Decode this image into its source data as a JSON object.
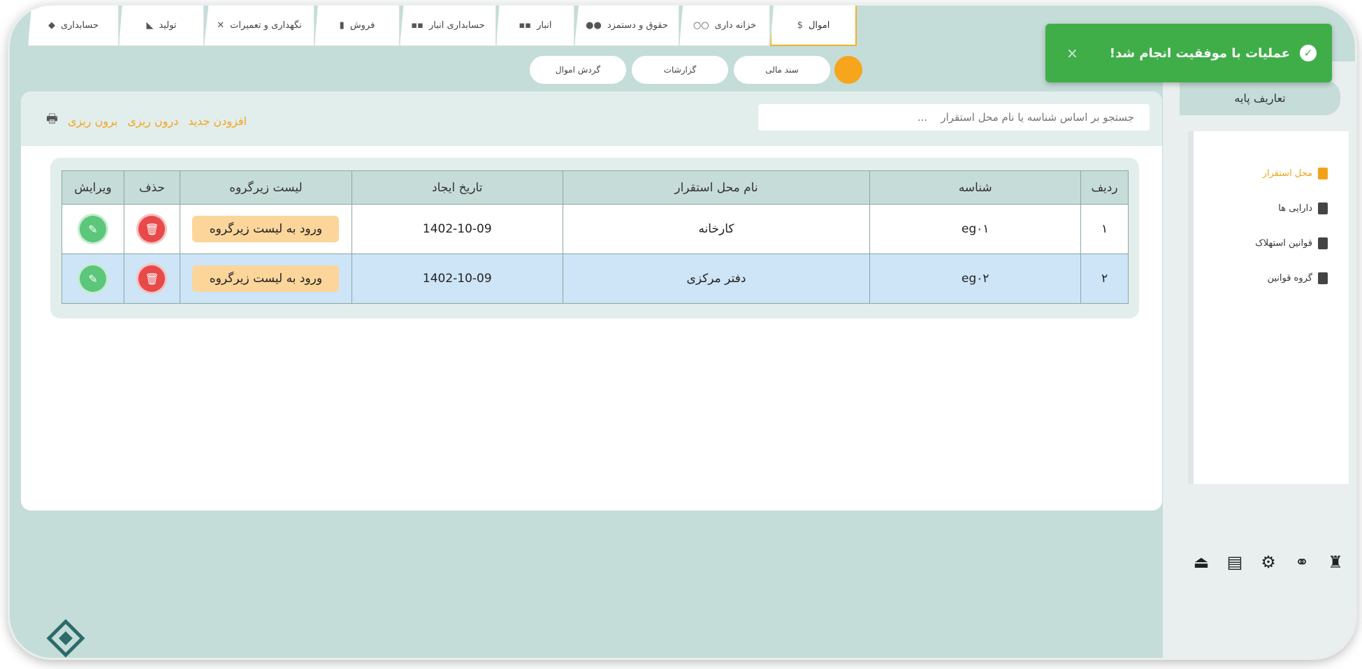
{
  "tabs": [
    {
      "label": "اموال",
      "icon": "money-doc-icon",
      "active": true
    },
    {
      "label": "خزانه داری",
      "icon": "coins-icon"
    },
    {
      "label": "حقوق و دستمزد",
      "icon": "users-icon"
    },
    {
      "label": "انبار",
      "icon": "boxes-icon"
    },
    {
      "label": "حسابداری انبار",
      "icon": "boxes-icon"
    },
    {
      "label": "فروش",
      "icon": "bar-chart-icon"
    },
    {
      "label": "نگهداری و تعمیرات",
      "icon": "tools-icon"
    },
    {
      "label": "تولید",
      "icon": "tag-icon"
    },
    {
      "label": "حسابداری",
      "icon": "diamond-icon"
    }
  ],
  "subnav": [
    {
      "label": "سند مالی"
    },
    {
      "label": "گزارشات"
    },
    {
      "label": "گردش اموال"
    }
  ],
  "toast": {
    "message": "عملیات  با موفقیت انجام شد!",
    "close": "×"
  },
  "search": {
    "placeholder": "جستجو بر اساس شناسه یا نام محل استقرار    ..."
  },
  "actions": {
    "add": "افزودن جدید",
    "import": "درون ریزی",
    "export": "برون ریزی"
  },
  "table": {
    "headers": [
      "ردیف",
      "شناسه",
      "نام محل استقرار",
      "تاریخ ایجاد",
      "لیست زیرگروه",
      "حذف",
      "ویرایش"
    ],
    "rows": [
      {
        "index": "۱",
        "id": "eg۰۱",
        "name": "کارخانه",
        "date": "1402-10-09",
        "sub": "ورود به لیست زیرگروه"
      },
      {
        "index": "۲",
        "id": "eg۰۲",
        "name": "دفتر مرکزی",
        "date": "1402-10-09",
        "sub": "ورود به لیست زیرگروه"
      }
    ]
  },
  "sidebar": {
    "title": "تعاریف پایه",
    "items": [
      {
        "label": "محل استقرار",
        "active": true
      },
      {
        "label": "دارایی ها"
      },
      {
        "label": "قوانین استهلاک"
      },
      {
        "label": "گروه قوانین"
      }
    ]
  },
  "colors": {
    "accent": "#f3a31b",
    "success": "#3fae49",
    "panel": "#c5ddd9"
  }
}
